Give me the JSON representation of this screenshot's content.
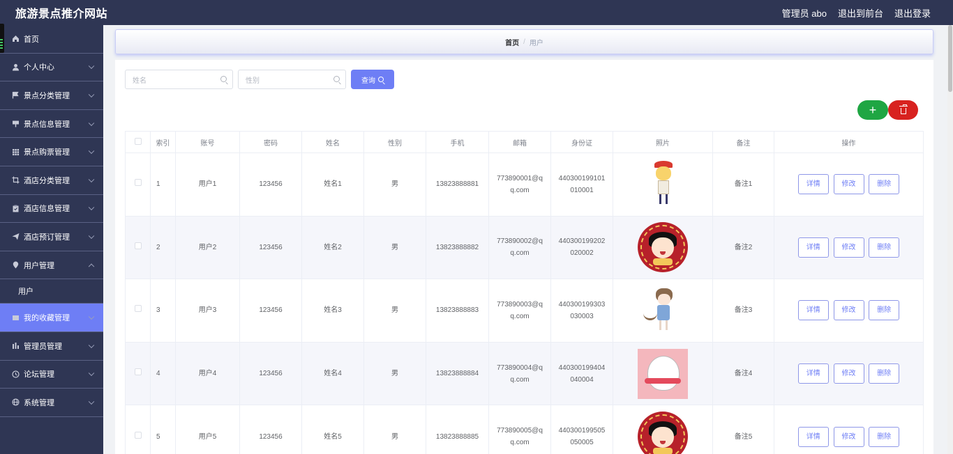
{
  "header": {
    "title": "旅游景点推介网站",
    "admin_label": "管理员 abo",
    "to_front": "退出到前台",
    "logout": "退出登录"
  },
  "sidebar": {
    "items": [
      {
        "label": "首页",
        "icon": "home-icon"
      },
      {
        "label": "个人中心",
        "icon": "user-icon"
      },
      {
        "label": "景点分类管理",
        "icon": "flag-icon"
      },
      {
        "label": "景点信息管理",
        "icon": "sign-icon"
      },
      {
        "label": "景点购票管理",
        "icon": "grid-icon"
      },
      {
        "label": "酒店分类管理",
        "icon": "crop-icon"
      },
      {
        "label": "酒店信息管理",
        "icon": "clipboard-icon"
      },
      {
        "label": "酒店预订管理",
        "icon": "send-icon"
      },
      {
        "label": "用户管理",
        "icon": "location-icon"
      },
      {
        "label": "我的收藏管理",
        "icon": "list-icon"
      },
      {
        "label": "管理员管理",
        "icon": "chart-icon"
      },
      {
        "label": "论坛管理",
        "icon": "clock-icon"
      },
      {
        "label": "系统管理",
        "icon": "globe-icon"
      }
    ],
    "submenu_user": "用户"
  },
  "breadcrumb": {
    "home": "首页",
    "separator": "/",
    "current": "用户"
  },
  "search": {
    "name_placeholder": "姓名",
    "gender_placeholder": "性别",
    "query_label": "查询"
  },
  "actions": {
    "add_label": "+"
  },
  "table": {
    "headers": [
      "索引",
      "账号",
      "密码",
      "姓名",
      "性别",
      "手机",
      "邮箱",
      "身份证",
      "照片",
      "备注",
      "操作"
    ],
    "rows": [
      {
        "index": "1",
        "account": "用户1",
        "password": "123456",
        "name": "姓名1",
        "gender": "男",
        "phone": "13823888881",
        "email": "773890001@qq.com",
        "id_card": "440300199101010001",
        "photo": "boy-avatar",
        "note": "备注1"
      },
      {
        "index": "2",
        "account": "用户2",
        "password": "123456",
        "name": "姓名2",
        "gender": "男",
        "phone": "13823888882",
        "email": "773890002@qq.com",
        "id_card": "440300199202020002",
        "photo": "girl-round-avatar",
        "note": "备注2"
      },
      {
        "index": "3",
        "account": "用户3",
        "password": "123456",
        "name": "姓名3",
        "gender": "男",
        "phone": "13823888883",
        "email": "773890003@qq.com",
        "id_card": "440300199303030003",
        "photo": "catgirl-avatar",
        "note": "备注3"
      },
      {
        "index": "4",
        "account": "用户4",
        "password": "123456",
        "name": "姓名4",
        "gender": "男",
        "phone": "13823888884",
        "email": "773890004@qq.com",
        "id_card": "440300199404040004",
        "photo": "cat-avatar",
        "note": "备注4"
      },
      {
        "index": "5",
        "account": "用户5",
        "password": "123456",
        "name": "姓名5",
        "gender": "男",
        "phone": "13823888885",
        "email": "773890005@qq.com",
        "id_card": "440300199505050005",
        "photo": "girl-round-avatar",
        "note": "备注5"
      }
    ],
    "row_actions": {
      "detail": "详情",
      "edit": "修改",
      "delete": "删除"
    }
  },
  "colors": {
    "sidebar_bg": "#2f3654",
    "accent": "#6e7ef5",
    "add": "#1fa643",
    "danger": "#d8221f"
  }
}
